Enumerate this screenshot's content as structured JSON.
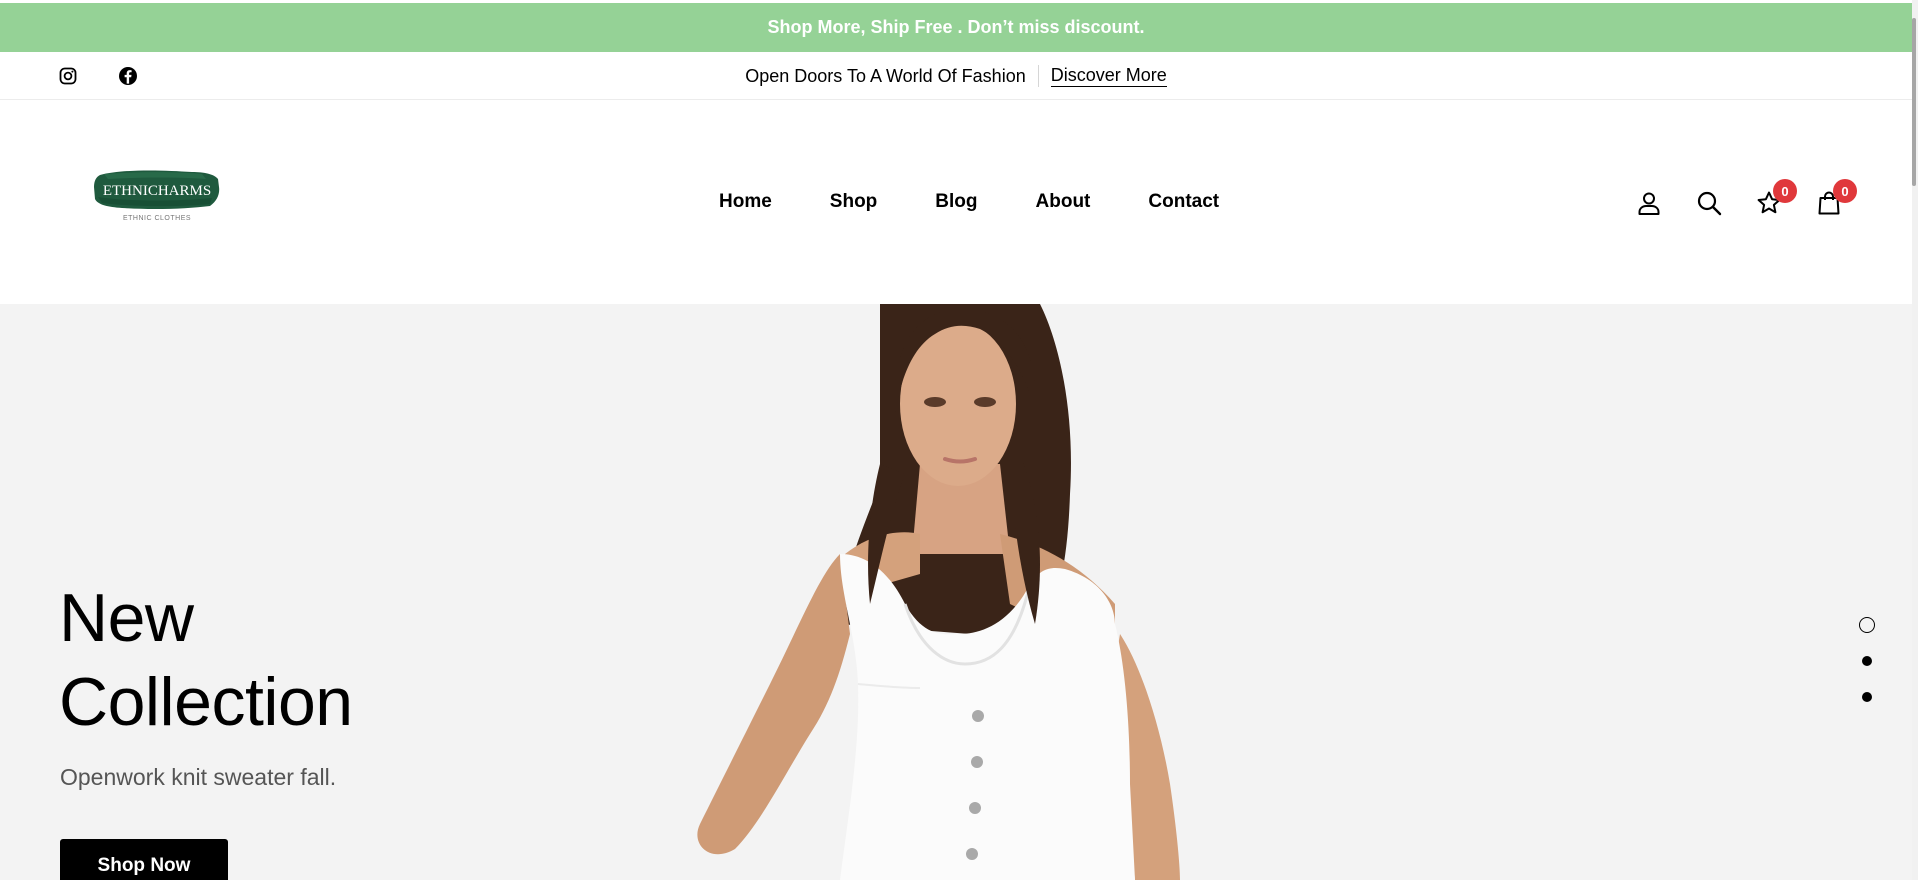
{
  "promo": {
    "text": "Shop More, Ship Free . Don’t miss discount."
  },
  "top_strip": {
    "social": [
      "instagram-icon",
      "facebook-icon"
    ],
    "tagline": "Open Doors To A World Of Fashion",
    "link": "Discover More"
  },
  "header": {
    "logo": {
      "brand": "ETHNICHARMS",
      "tagline": "ETHNIC CLOTHES"
    },
    "nav": [
      {
        "label": "Home"
      },
      {
        "label": "Shop"
      },
      {
        "label": "Blog"
      },
      {
        "label": "About"
      },
      {
        "label": "Contact"
      }
    ],
    "icons": [
      "user-icon",
      "search-icon",
      "star-icon",
      "bag-icon"
    ],
    "wishlist_count": "0",
    "cart_count": "0"
  },
  "hero": {
    "title_line1": "New",
    "title_line2": "Collection",
    "subtitle": "Openwork knit sweater fall.",
    "button": "Shop Now",
    "slides": {
      "total": 3,
      "active": 1
    }
  },
  "colors": {
    "promo_bg": "#95d296",
    "badge": "#e0383b",
    "hero_bg": "#f3f3f3",
    "button_bg": "#000000"
  }
}
